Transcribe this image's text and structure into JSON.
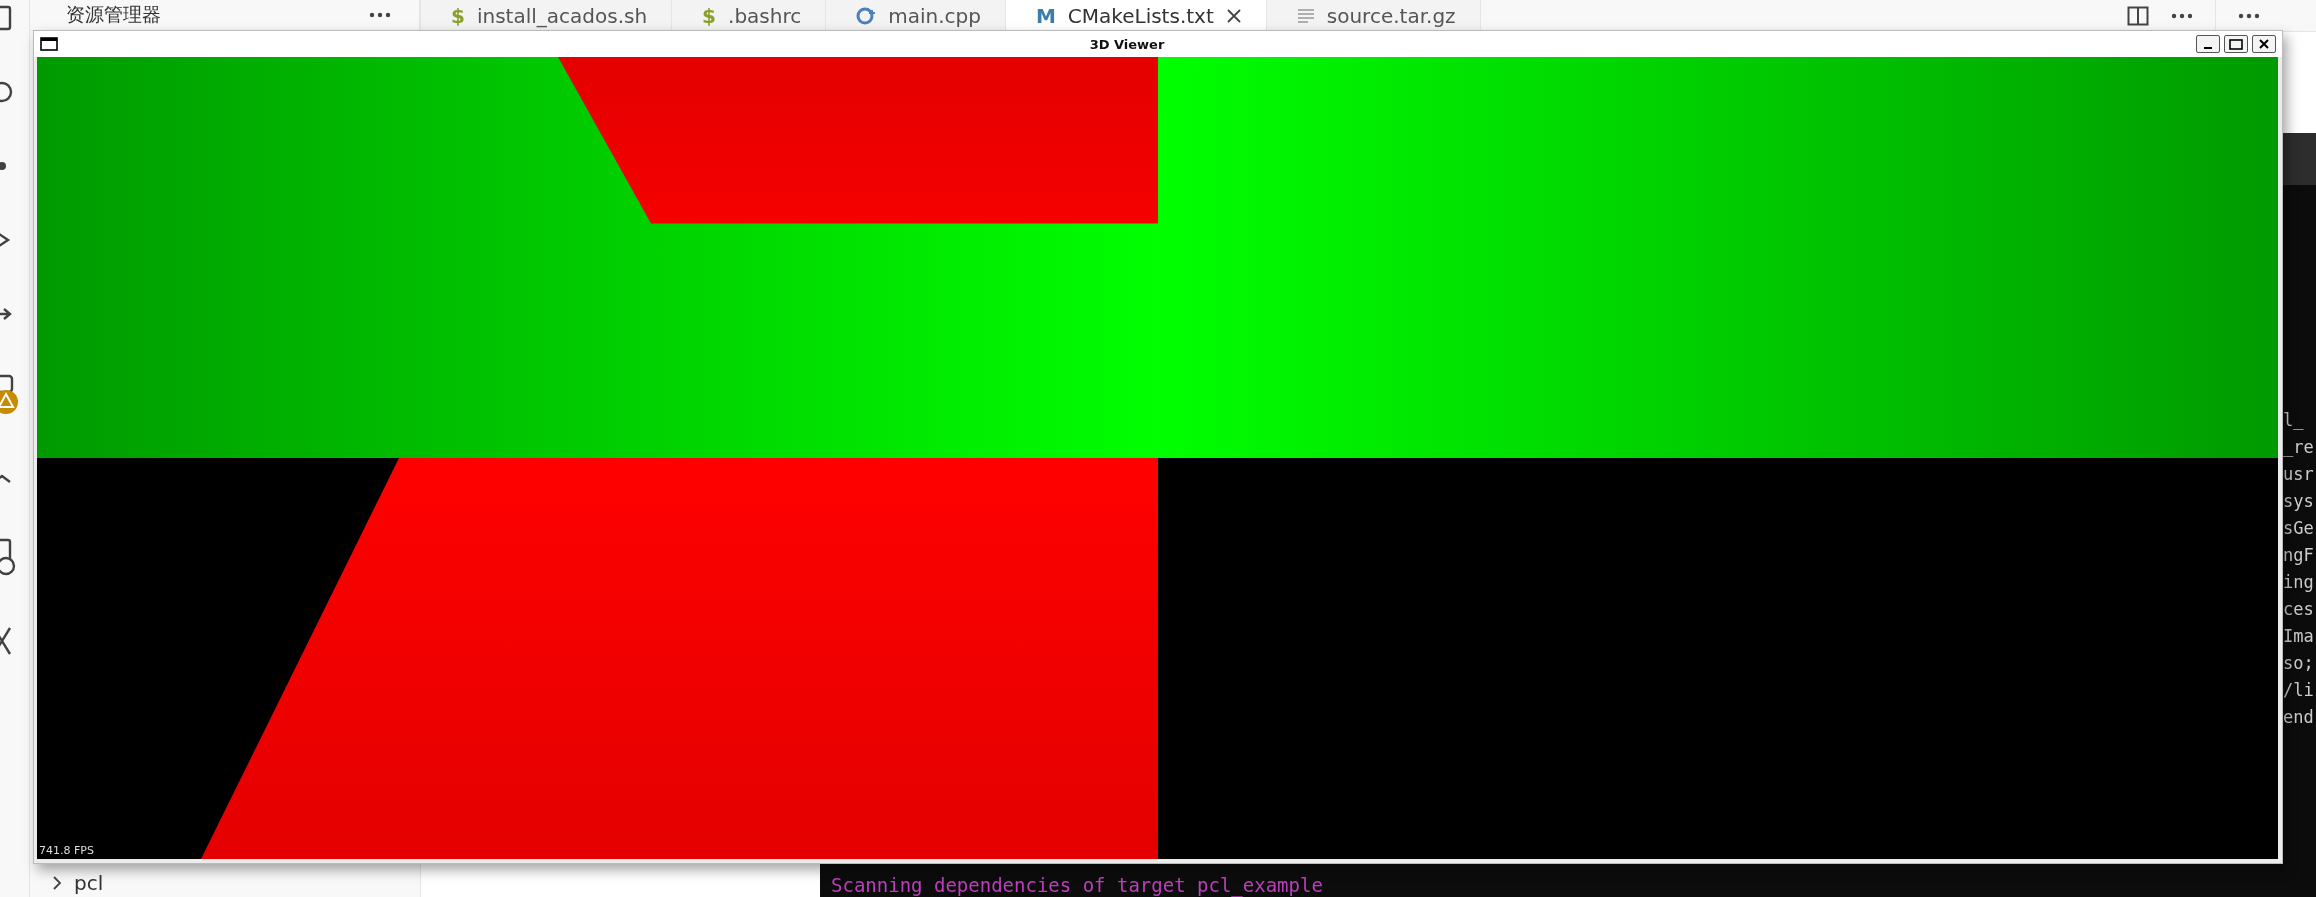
{
  "explorer": {
    "title": "资源管理器",
    "items": [
      {
        "label": "pcl",
        "expanded": false
      }
    ]
  },
  "tabs": [
    {
      "label": "install_acados.sh",
      "kind": "shell",
      "icon": "$",
      "selected": false
    },
    {
      "label": ".bashrc",
      "kind": "shell",
      "icon": "$",
      "selected": false
    },
    {
      "label": "main.cpp",
      "kind": "cpp",
      "selected": false
    },
    {
      "label": "CMakeLists.txt",
      "kind": "cmake",
      "icon": "M",
      "selected": true
    },
    {
      "label": "source.tar.gz",
      "kind": "file",
      "selected": false
    }
  ],
  "terminal": {
    "lines": [
      "l_",
      "_re",
      "usr",
      "sys",
      "sGe",
      "ngF",
      "ing",
      "ces",
      "Ima",
      "so;",
      "/li",
      "end"
    ],
    "last_line": "Scanning dependencies of target pcl_example"
  },
  "viewer": {
    "title": "3D Viewer",
    "fps": "741.8 FPS"
  }
}
